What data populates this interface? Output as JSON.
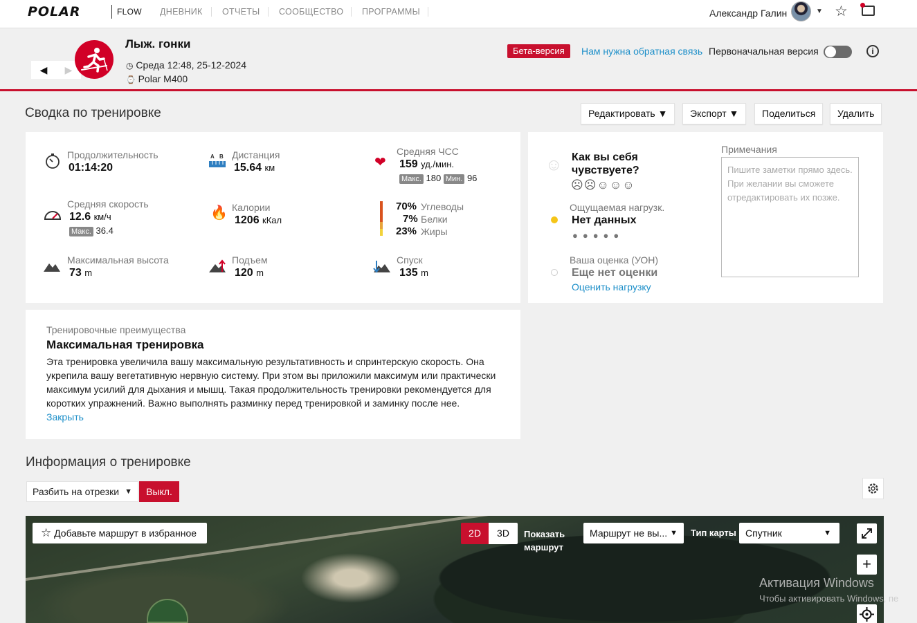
{
  "nav": {
    "logo": "POLAR",
    "flow": "FLOW",
    "items": [
      "ДНЕВНИК",
      "ОТЧЕТЫ",
      "СООБЩЕСТВО",
      "ПРОГРАММЫ"
    ],
    "user_name": "Александр Галин"
  },
  "header": {
    "title": "Лыж. гонки",
    "datetime": "Среда 12:48, 25-12-2024",
    "device": "Polar M400",
    "beta": "Бета-версия",
    "feedback": "Нам нужна обратная связь",
    "original_version": "Первоначальная версия",
    "prev": "◀",
    "next": "▶",
    "info": "i"
  },
  "summary": {
    "title": "Сводка по тренировке",
    "buttons": {
      "edit": "Редактировать ▼",
      "export": "Экспорт ▼",
      "share": "Поделиться",
      "delete": "Удалить"
    },
    "duration": {
      "label": "Продолжительность",
      "value": "01:14:20"
    },
    "distance": {
      "label": "Дистанция",
      "value": "15.64",
      "unit": "км"
    },
    "hr": {
      "label": "Средняя ЧСС",
      "value": "159",
      "unit": "уд./мин.",
      "max_label": "Макс.",
      "max": "180",
      "min_label": "Мин.",
      "min": "96"
    },
    "speed": {
      "label": "Средняя скорость",
      "value": "12.6",
      "unit": "км/ч",
      "max_label": "Макс.",
      "max": "36.4"
    },
    "calories": {
      "label": "Калории",
      "value": "1206",
      "unit": "кКал"
    },
    "carbs": {
      "pct": "70%",
      "label": "Углеводы"
    },
    "protein": {
      "pct": "7%",
      "label": "Белки"
    },
    "fat": {
      "pct": "23%",
      "label": "Жиры"
    },
    "altitude": {
      "label": "Максимальная высота",
      "value": "73",
      "unit": "m"
    },
    "ascent": {
      "label": "Подъем",
      "value": "120",
      "unit": "m"
    },
    "descent": {
      "label": "Спуск",
      "value": "135",
      "unit": "m"
    }
  },
  "feeling": {
    "question": "Как вы себя чувствуете?",
    "perceived_label": "Ощущаемая нагрузк.",
    "perceived_value": "Нет данных",
    "rating_label": "Ваша оценка (УОН)",
    "rating_value": "Еще нет оценки",
    "rate_link": "Оценить нагрузку",
    "notes_label": "Примечания",
    "notes_placeholder": "Пишите заметки прямо здесь. При желании вы сможете отредактировать их позже."
  },
  "benefit": {
    "label": "Тренировочные преимущества",
    "title": "Максимальная тренировка",
    "text": "Эта тренировка увеличила вашу максимальную результативность и спринтерскую скорость. Она укрепила вашу вегетативную нервную систему. При этом вы приложили максимум или практически максимум усилий для дыхания и мышц. Такая продолжительность тренировки рекомендуется для коротких упражнений. Важно выполнять разминку перед тренировкой и заминку после нее.",
    "close": "Закрыть"
  },
  "info_section": {
    "title": "Информация о тренировке",
    "segments": "Разбить на отрезки",
    "segments_state": "Выкл."
  },
  "map": {
    "favorite": "Добавьте маршрут в избранное",
    "mode_2d": "2D",
    "mode_3d": "3D",
    "show_route": "Показать маршрут",
    "route_select": "Маршрут не вы...",
    "map_type_label": "Тип карты",
    "map_type": "Спутник",
    "zoom_in": "+"
  },
  "watermark": {
    "title": "Активация Windows",
    "subtitle": "Чтобы активировать Windows, пе"
  },
  "colors": {
    "accent": "#c8102e",
    "link": "#1d8fc9"
  }
}
